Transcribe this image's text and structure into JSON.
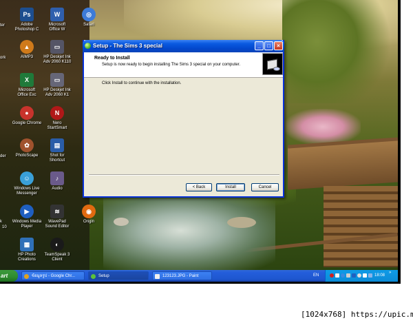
{
  "desktop": {
    "icons": [
      {
        "name": "adobe-photoshop",
        "label": "Adobe\nPhotoshop C",
        "glyph": "Ps",
        "color": "#1d4e8f"
      },
      {
        "name": "microsoft-office",
        "label": "Microsoft\nOffice W",
        "glyph": "W",
        "color": "#2f5fad"
      },
      {
        "name": "safari",
        "label": "Safari",
        "glyph": "◎",
        "color": "#3d7bd8"
      },
      {
        "name": "aimp3",
        "label": "AIMP3",
        "glyph": "▲",
        "color": "#d07a1a"
      },
      {
        "name": "hp-deskjet-2050",
        "label": "HP Deskjet Ink\nAdv 2060 K110",
        "glyph": "▭",
        "color": "#556"
      },
      {
        "name": "microsoft-office-2",
        "label": "Microsoft\nOffice Exc",
        "glyph": "X",
        "color": "#1f7a3a"
      },
      {
        "name": "hp-deskjet-2050-b",
        "label": "HP Deskjet Ink\nAdv 2060 K1",
        "glyph": "▭",
        "color": "#667"
      },
      {
        "name": "google-chrome",
        "label": "Google Chrome",
        "glyph": "●",
        "color": "#c8332c"
      },
      {
        "name": "nero-startsmart",
        "label": "Nero\nStartSmart",
        "glyph": "N",
        "color": "#b01818"
      },
      {
        "name": "photoscape",
        "label": "PhotoScape",
        "glyph": "✿",
        "color": "#a0522d"
      },
      {
        "name": "shot-for-shortcut",
        "label": "Shot for\nShortcut",
        "glyph": "▤",
        "color": "#2a5da8"
      },
      {
        "name": "windows-live-messenger",
        "label": "Windows Live\nMessenger",
        "glyph": "☺",
        "color": "#3aa0d8"
      },
      {
        "name": "audio",
        "label": "Audio",
        "glyph": "♪",
        "color": "#6a5a8a"
      },
      {
        "name": "windows-media-player",
        "label": "Windows Media\nPlayer",
        "glyph": "▶",
        "color": "#1f5fc0"
      },
      {
        "name": "wavepad-sound-editor",
        "label": "WavePad\nSound Editor",
        "glyph": "≋",
        "color": "#333"
      },
      {
        "name": "origin",
        "label": "Origin",
        "glyph": "◉",
        "color": "#e06a10"
      },
      {
        "name": "hp-photo-creations",
        "label": "HP Photo\nCreations",
        "glyph": "▦",
        "color": "#2f70b8"
      },
      {
        "name": "teamspeak-3-client",
        "label": "TeamSpeak 3\nClient",
        "glyph": "◐",
        "color": "#1a1a1a"
      }
    ],
    "cut_labels": [
      "ter",
      "ork",
      "der",
      "k",
      "10"
    ]
  },
  "dialog": {
    "title": "Setup - The Sims 3 special",
    "header_title": "Ready to Install",
    "header_subtitle": "Setup is now ready to begin installing The Sims 3 special on your computer.",
    "body_text": "Click Install to continue with the installation.",
    "buttons": {
      "back": "< Back",
      "install": "Install",
      "cancel": "Cancel"
    },
    "window_controls": {
      "minimize": "_",
      "maximize": "□",
      "close": "×"
    }
  },
  "taskbar": {
    "start_label": "art",
    "tasks": [
      {
        "label": "ข้อมูลรูป - Google Chr...",
        "icon_color": "#e0a020"
      },
      {
        "label": "Setup",
        "icon_color": "#5cc23a"
      },
      {
        "label": "123123.JPG - Paint",
        "icon_color": "#f0f0f0"
      }
    ],
    "language": "EN",
    "clock": "18:08",
    "tray_arrow": "»"
  },
  "watermark": "[1024x768] https://upic.me/"
}
